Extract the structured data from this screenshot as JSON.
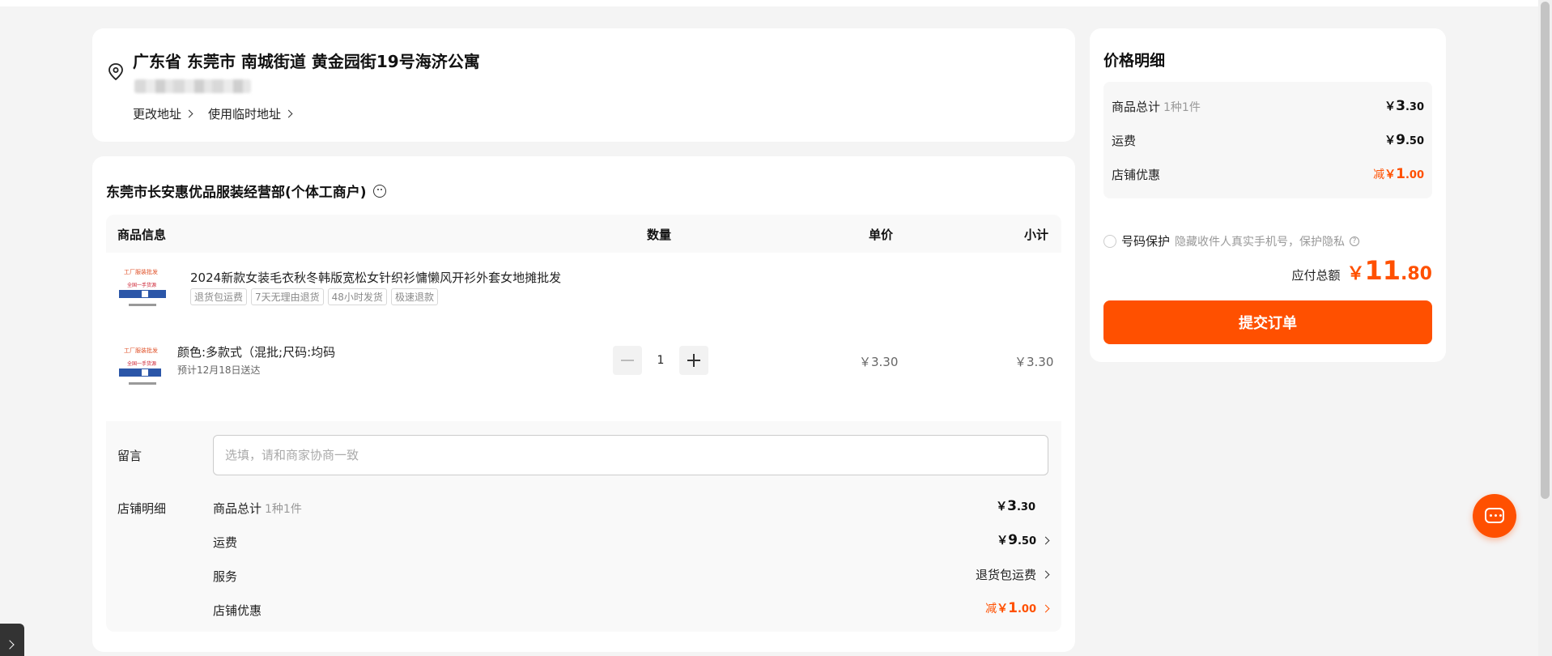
{
  "address": {
    "full": "广东省 东莞市 南城街道 黄金园街19号海济公寓",
    "change_label": "更改地址",
    "temp_label": "使用临时地址"
  },
  "shop": {
    "name": "东莞市长安惠优品服装经营部(个体工商户)",
    "table_headers": {
      "info": "商品信息",
      "qty": "数量",
      "unit_price": "单价",
      "subtotal": "小计"
    },
    "product": {
      "title": "2024新款女装毛衣秋冬韩版宽松女针织衫慵懒风开衫外套女地摊批发",
      "tags": [
        "退货包运费",
        "7天无理由退货",
        "48小时发货",
        "极速退款"
      ],
      "thumb_text_1": "工厂服装批发",
      "thumb_text_2": "全国一手货源",
      "sku": "颜色:多款式（混批;尺码:均码",
      "eta": "预计12月18日送达",
      "quantity": "1",
      "unit_price": "￥3.30",
      "subtotal": "￥3.30"
    },
    "note_label": "留言",
    "note_placeholder": "选填，请和商家协商一致",
    "detail_label": "店铺明细",
    "details": {
      "goods_label": "商品总计",
      "goods_sub": "1种1件",
      "goods_cur": "￥",
      "goods_big": "3",
      "goods_small": ".30",
      "ship_label": "运费",
      "ship_cur": "￥",
      "ship_big": "9",
      "ship_small": ".50",
      "service_label": "服务",
      "service_value": "退货包运费",
      "discount_label": "店铺优惠",
      "discount_prefix": "减",
      "discount_cur": "￥",
      "discount_big": "1",
      "discount_small": ".00"
    }
  },
  "price_panel": {
    "title": "价格明细",
    "goods_label": "商品总计",
    "goods_sub": "1种1件",
    "goods_cur": "￥",
    "goods_big": "3",
    "goods_small": ".30",
    "ship_label": "运费",
    "ship_cur": "￥",
    "ship_big": "9",
    "ship_small": ".50",
    "discount_label": "店铺优惠",
    "discount_prefix": "减",
    "discount_cur": "￥",
    "discount_big": "1",
    "discount_small": ".00",
    "protect_label": "号码保护",
    "protect_hint": "隐藏收件人真实手机号，保护隐私",
    "total_label": "应付总额",
    "total_cur": "￥",
    "total_big": "11",
    "total_small": ".80",
    "submit_label": "提交订单"
  },
  "colors": {
    "accent": "#ff5000",
    "background": "#f4f4f4"
  },
  "icons": [
    "location-pin-icon",
    "smile-icon",
    "chevron-right-icon",
    "minus-icon",
    "plus-icon",
    "question-icon",
    "chat-icon"
  ]
}
